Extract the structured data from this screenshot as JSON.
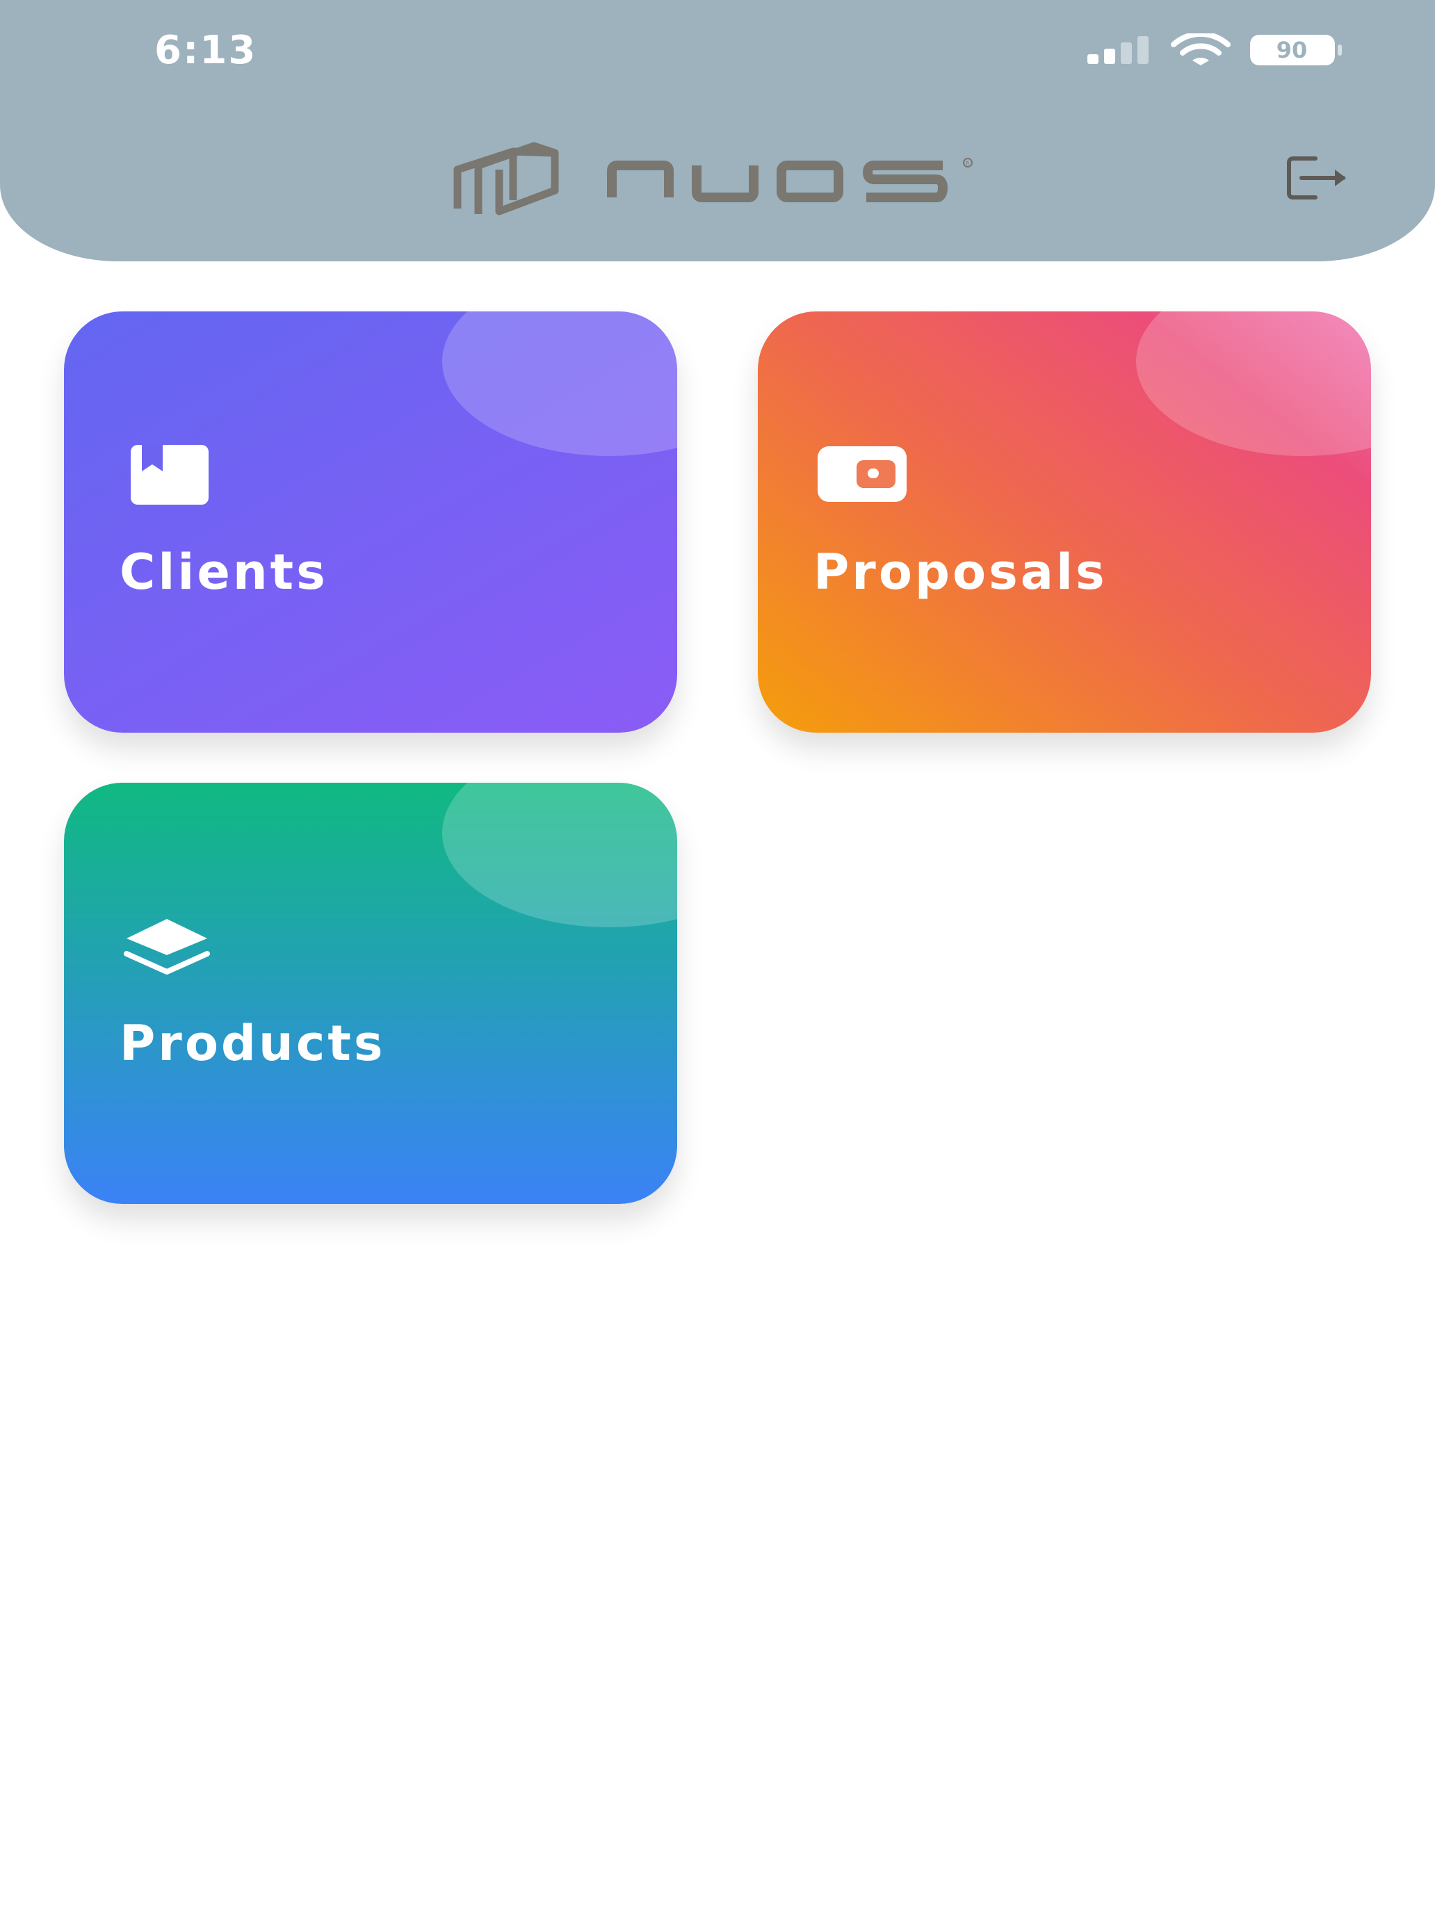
{
  "status_bar": {
    "time": "6:13",
    "battery": "90",
    "icons": [
      "signal-icon",
      "wifi-icon",
      "battery-icon"
    ]
  },
  "header": {
    "logo_text": "nuos",
    "logout_icon": "logout-icon",
    "background": "#9db2bd"
  },
  "tiles": [
    {
      "label": "Clients",
      "icon": "bookmark-card-icon",
      "colors": [
        "#6366f1",
        "#8b5cf6"
      ]
    },
    {
      "label": "Proposals",
      "icon": "wallet-icon",
      "colors": [
        "#f59e0b",
        "#ec4d7a",
        "#ef6fae"
      ]
    },
    {
      "label": "Products",
      "icon": "layers-icon",
      "colors": [
        "#10b981",
        "#3b82f6"
      ]
    }
  ]
}
